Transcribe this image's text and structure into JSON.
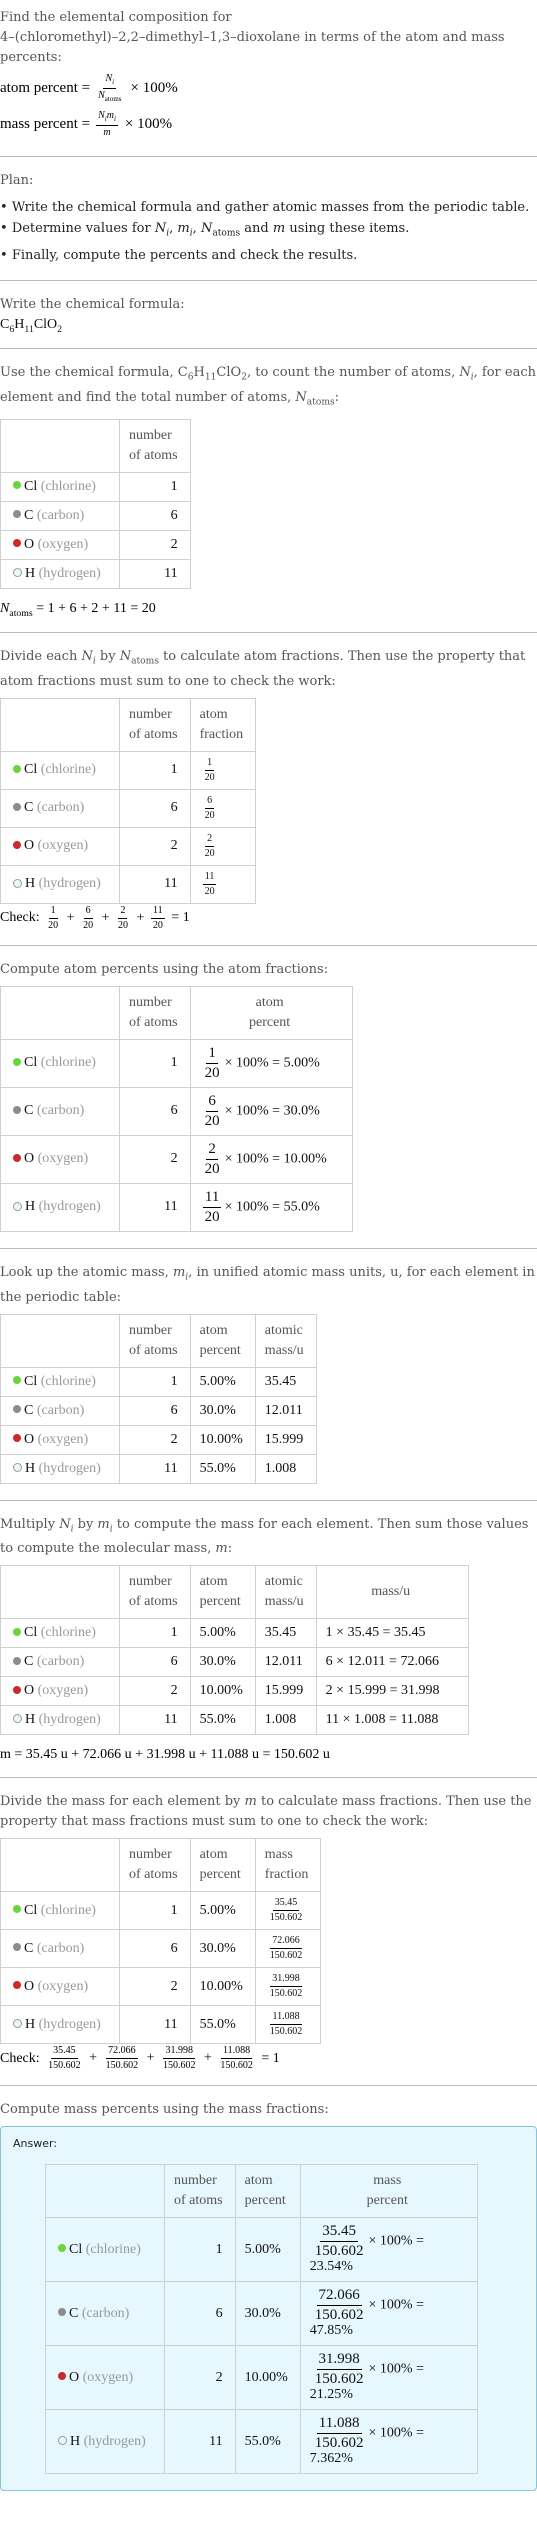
{
  "header": {
    "question_line1": "Find the elemental composition for",
    "question_line2": "4–(chloromethyl)–2,2–dimethyl–1,3–dioxolane in terms of the atom and mass percents:",
    "atom_percent_label": "atom percent =",
    "mass_percent_label": "mass percent =",
    "times_100": "× 100%"
  },
  "plan": {
    "title": "Plan:",
    "items": [
      "Write the chemical formula and gather atomic masses from the periodic table.",
      "Determine values for N_i, m_i, N_atoms and m using these items.",
      "Finally, compute the percents and check the results."
    ]
  },
  "formula": {
    "intro": "Write the chemical formula:",
    "parts": [
      "C",
      "6",
      "H",
      "11",
      "ClO",
      "2"
    ]
  },
  "colors": {
    "chlorine": "#6ad43b",
    "carbon": "#8c8c8c",
    "oxygen": "#cc2a2a",
    "hydrogen": "#e8f8fb",
    "answer_bg": "#e6f7fd",
    "answer_border": "#86c5d9"
  },
  "elements": [
    {
      "symbol": "Cl",
      "name": "(chlorine)",
      "atoms": "1",
      "fraction_num": "1",
      "fraction_den": "20",
      "atom_percent": "5.00%",
      "atomic_mass": "35.45",
      "mass_calc": "1 × 35.45 = 35.45",
      "mass": "35.45",
      "mass_percent": "23.54%"
    },
    {
      "symbol": "C",
      "name": "(carbon)",
      "atoms": "6",
      "fraction_num": "6",
      "fraction_den": "20",
      "atom_percent": "30.0%",
      "atomic_mass": "12.011",
      "mass_calc": "6 × 12.011 = 72.066",
      "mass": "72.066",
      "mass_percent": "47.85%"
    },
    {
      "symbol": "O",
      "name": "(oxygen)",
      "atoms": "2",
      "fraction_num": "2",
      "fraction_den": "20",
      "atom_percent": "10.00%",
      "atomic_mass": "15.999",
      "mass_calc": "2 × 15.999 = 31.998",
      "mass": "31.998",
      "mass_percent": "21.25%"
    },
    {
      "symbol": "H",
      "name": "(hydrogen)",
      "atoms": "11",
      "fraction_num": "11",
      "fraction_den": "20",
      "atom_percent": "55.0%",
      "atomic_mass": "1.008",
      "mass_calc": "11 × 1.008 = 11.088",
      "mass": "11.088",
      "mass_percent": "7.362%"
    }
  ],
  "headers": {
    "atoms": "number of atoms",
    "atom_fraction": "atom fraction",
    "atom_percent": "atom percent",
    "atomic_mass": "atomic mass/u",
    "mass": "mass/u",
    "mass_fraction": "mass fraction",
    "mass_percent": "mass percent"
  },
  "step_count": {
    "intro": "Use the chemical formula, C6H11ClO2, to count the number of atoms, N_i, for each element and find the total number of atoms, N_atoms:",
    "result": "N_atoms = 1 + 6 + 2 + 11 = 20"
  },
  "step_fraction": {
    "intro": "Divide each N_i by N_atoms to calculate atom fractions. Then use the property that atom fractions must sum to one to check the work:",
    "check_label": "Check:",
    "check_result": "= 1"
  },
  "step_atom_percent": {
    "intro": "Compute atom percents using the atom fractions:"
  },
  "step_atomic_mass": {
    "intro": "Look up the atomic mass, m_i, in unified atomic mass units, u, for each element in the periodic table:"
  },
  "step_mass": {
    "intro": "Multiply N_i by m_i to compute the mass for each element. Then sum those values to compute the molecular mass, m:",
    "result": "m = 35.45 u + 72.066 u + 31.998 u + 11.088 u = 150.602 u",
    "total": "150.602"
  },
  "step_mass_fraction": {
    "intro": "Divide the mass for each element by m to calculate mass fractions. Then use the property that mass fractions must sum to one to check the work:",
    "check_label": "Check:",
    "check_result": "= 1"
  },
  "step_mass_percent": {
    "intro": "Compute mass percents using the mass fractions:",
    "answer_label": "Answer:"
  }
}
